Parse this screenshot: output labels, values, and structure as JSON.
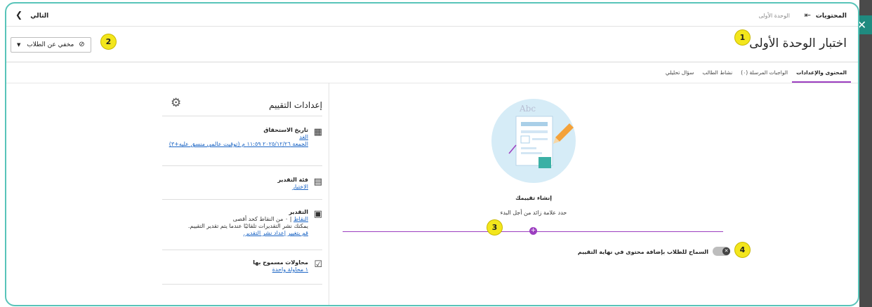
{
  "topbar": {
    "next_label": "التالي",
    "next_icon": "chevron-left-icon",
    "breadcrumb_current": "المحتويات",
    "breadcrumb_exit_icon": "exit-arrow-icon",
    "breadcrumb_unit": "الوحدة الأولى"
  },
  "header": {
    "title": "اختبار الوحدة الأولى",
    "visibility_label": "مخفي عن الطلاب",
    "visibility_icon": "eye-slash-icon"
  },
  "tabs": [
    {
      "label": "المحتوى والإعدادات",
      "active": true
    },
    {
      "label": "الواجبات المرسلة (٠)",
      "active": false
    },
    {
      "label": "نشاط الطالب",
      "active": false
    },
    {
      "label": "سؤال تحليلي",
      "active": false
    }
  ],
  "settings": {
    "title": "إعدادات التقييم",
    "gear_icon": "gear-icon",
    "due_date": {
      "icon": "calendar-icon",
      "title": "تاريخ الاستحقاق",
      "line1": "الغد",
      "line2": "الجمعة ٢٠٢٥/١٢/٢٦ ١١:٥٩ م (توقيت عالمي منسق عليه+٣)"
    },
    "grade_category": {
      "icon": "clipboard-icon",
      "title": "فئة التقدير",
      "value": "الاختبار"
    },
    "grading": {
      "icon": "grade-sheet-icon",
      "title": "التقدير",
      "points_link": "النقاط",
      "points_text": "| ٠ من النقاط كحد أقصى",
      "note": "يمكنك نشر التقديرات تلقائيًا عندما يتم تقدير التقييم.",
      "note_link": "قم بتغيير إعداد نشر التقدير."
    },
    "attempts": {
      "icon": "checkbox-icon",
      "title": "محاولات مسموح بها",
      "value": "١ محاولة واحدة"
    }
  },
  "content": {
    "create_title": "إنشاء تقييمك",
    "create_subtitle": "حدد علامة زائد من أجل البدء",
    "add_icon": "plus-icon",
    "toggle_label": "السماح للطلاب بإضافة محتوى في نهاية التقييم",
    "toggle_state": "off"
  },
  "callouts": [
    "1",
    "2",
    "3",
    "4"
  ],
  "colors": {
    "accent": "#9c3ec0",
    "link": "#1a64c4",
    "callout": "#f3e61c",
    "frame": "#58c4b9"
  }
}
